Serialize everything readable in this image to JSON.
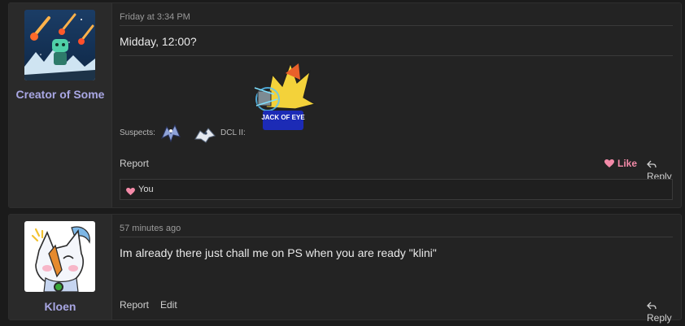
{
  "posts": [
    {
      "username": "Creator of Some",
      "date": "Friday at 3:34 PM",
      "message": "Midday, 12:00?",
      "signature": {
        "suspects_label": "Suspects:",
        "dcl_label": "DCL II:",
        "banner_text": "JACK OF EYE"
      },
      "actions": {
        "report": "Report",
        "like": "Like",
        "reply": "Reply"
      },
      "likes_text": "You"
    },
    {
      "username": "Kloen",
      "date": "57 minutes ago",
      "message": "Im already there just chall me on PS when you are ready \"klini\"",
      "actions": {
        "report": "Report",
        "edit": "Edit",
        "reply": "Reply"
      }
    }
  ],
  "colors": {
    "username": "#a9a7e4",
    "like": "#f38aa8",
    "online": "#3aa83a"
  }
}
